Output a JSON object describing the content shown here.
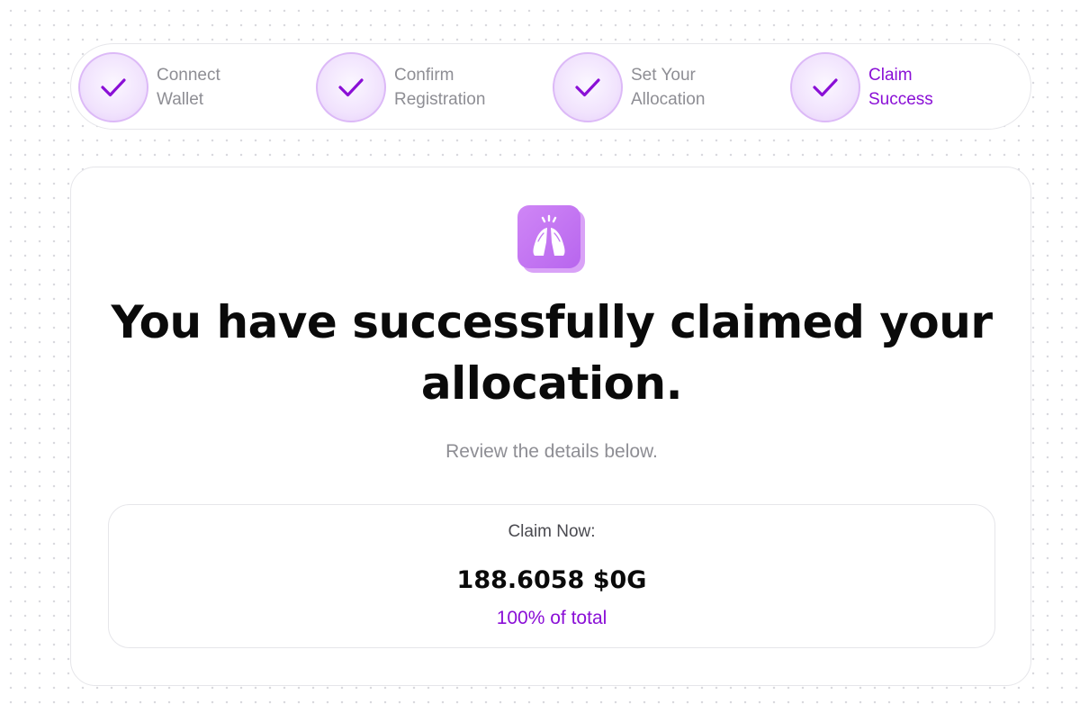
{
  "colors": {
    "accent": "#8a0fd6",
    "step_circle_bg": "#f1e3fd",
    "step_circle_border": "#dcb9f7",
    "muted_text": "#8e8e94",
    "icon_bg": "#cf86f6"
  },
  "stepper": {
    "steps": [
      {
        "line1": "Connect",
        "line2": "Wallet",
        "icon": "checkmark-icon",
        "state": "complete"
      },
      {
        "line1": "Confirm",
        "line2": "Registration",
        "icon": "checkmark-icon",
        "state": "complete"
      },
      {
        "line1": "Set Your",
        "line2": "Allocation",
        "icon": "checkmark-icon",
        "state": "complete"
      },
      {
        "line1": "Claim",
        "line2": "Success",
        "icon": "checkmark-icon",
        "state": "current"
      }
    ]
  },
  "success": {
    "icon": "high-five-hands-icon",
    "headline_line1": "You have successfully claimed your",
    "headline_line2": "allocation.",
    "subtext": "Review the details below."
  },
  "claim": {
    "label": "Claim Now:",
    "amount": "188.6058 $0G",
    "percent": "100% of total"
  }
}
